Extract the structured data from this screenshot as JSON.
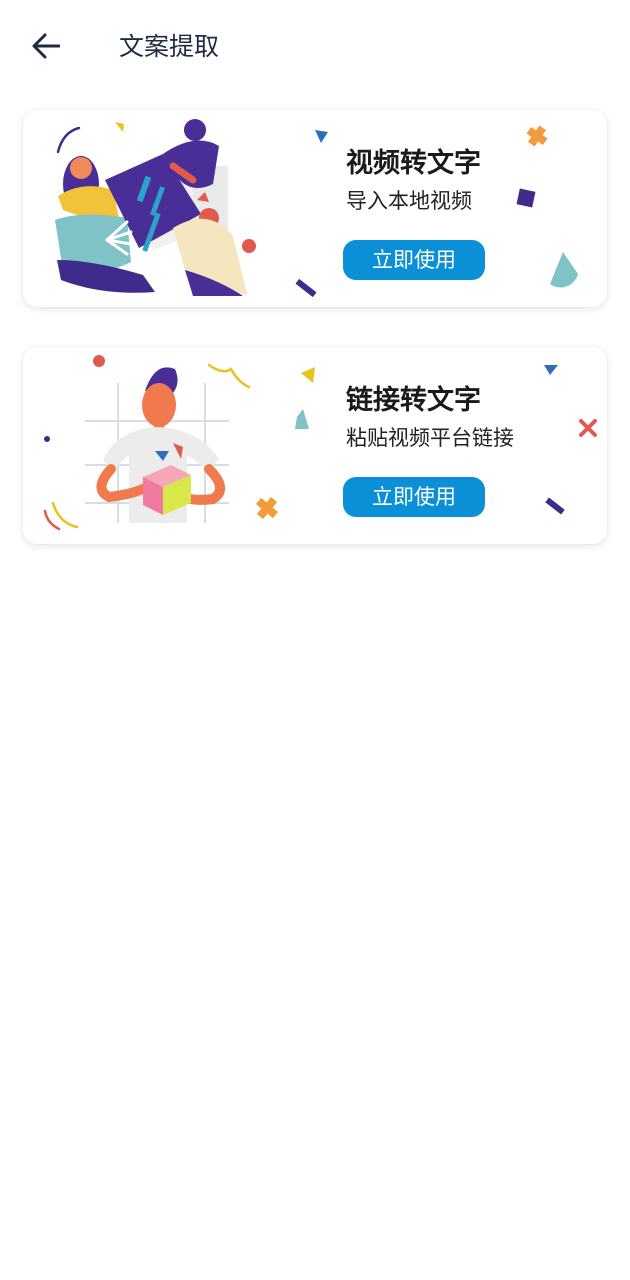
{
  "header": {
    "title": "文案提取",
    "back_icon": "arrow-left-icon"
  },
  "cards": [
    {
      "title": "视频转文字",
      "subtitle": "导入本地视频",
      "button_label": "立即使用"
    },
    {
      "title": "链接转文字",
      "subtitle": "粘贴视频平台链接",
      "button_label": "立即使用"
    }
  ],
  "colors": {
    "accent": "#0b8fd6",
    "title_text": "#1f2a44",
    "background": "#ffffff"
  }
}
